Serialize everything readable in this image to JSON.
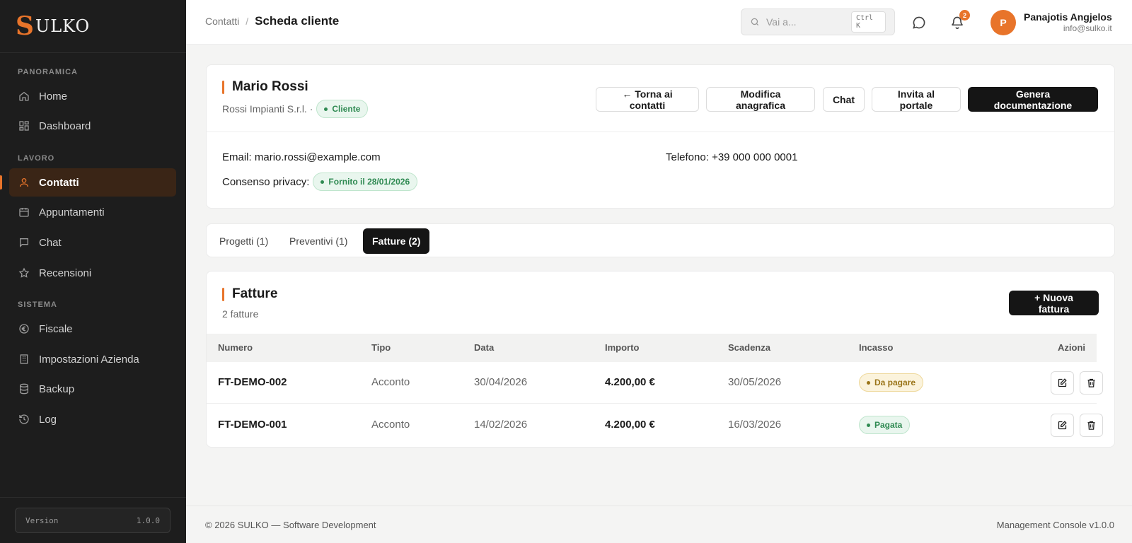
{
  "brand": {
    "logo_mark": "S",
    "logo_text": "ULKO",
    "accent": "#e8742a"
  },
  "sidebar": {
    "sections": [
      {
        "label": "PANORAMICA"
      },
      {
        "label": "LAVORO"
      },
      {
        "label": "SISTEMA"
      }
    ],
    "items": [
      {
        "label": "Home",
        "icon": "home-icon"
      },
      {
        "label": "Dashboard",
        "icon": "dashboard-icon"
      },
      {
        "label": "Contatti",
        "icon": "user-icon",
        "active": true
      },
      {
        "label": "Appuntamenti",
        "icon": "calendar-icon"
      },
      {
        "label": "Chat",
        "icon": "chat-icon"
      },
      {
        "label": "Recensioni",
        "icon": "star-icon"
      },
      {
        "label": "Fiscale",
        "icon": "euro-icon"
      },
      {
        "label": "Impostazioni Azienda",
        "icon": "building-icon"
      },
      {
        "label": "Backup",
        "icon": "database-icon"
      },
      {
        "label": "Log",
        "icon": "history-icon"
      }
    ],
    "version_label": "Version",
    "version_value": "1.0.0"
  },
  "topbar": {
    "breadcrumb_parent": "Contatti",
    "breadcrumb_sep": "/",
    "breadcrumb_current": "Scheda cliente",
    "search_placeholder": "Vai a...",
    "search_shortcut": "Ctrl K",
    "notification_count": "2",
    "user_initial": "P",
    "user_name": "Panajotis Angjelos",
    "user_email": "info@sulko.it"
  },
  "client": {
    "name": "Mario Rossi",
    "company": "Rossi Impianti S.r.l. ·",
    "status": "Cliente",
    "email_label": "Email:",
    "email": "mario.rossi@example.com",
    "phone_label": "Telefono:",
    "phone": "+39 000 000 0001",
    "privacy_label": "Consenso privacy:",
    "privacy_status": "Fornito il 28/01/2026",
    "actions": {
      "back": "← Torna ai contatti",
      "edit": "Modifica anagrafica",
      "chat": "Chat",
      "invite": "Invita al portale",
      "generate": "Genera documentazione"
    }
  },
  "tabs": [
    {
      "label": "Progetti (1)"
    },
    {
      "label": "Preventivi (1)"
    },
    {
      "label": "Fatture (2)",
      "active": true
    }
  ],
  "invoices": {
    "title": "Fatture",
    "subtitle": "2 fatture",
    "new_button": "+ Nuova fattura",
    "columns": [
      "Numero",
      "Tipo",
      "Data",
      "Importo",
      "Scadenza",
      "Incasso",
      "Azioni"
    ],
    "rows": [
      {
        "numero": "FT-DEMO-002",
        "tipo": "Acconto",
        "data": "30/04/2026",
        "importo": "4.200,00 €",
        "scadenza": "30/05/2026",
        "incasso": "Da pagare",
        "incasso_color": "#9a7418"
      },
      {
        "numero": "FT-DEMO-001",
        "tipo": "Acconto",
        "data": "14/02/2026",
        "importo": "4.200,00 €",
        "scadenza": "16/03/2026",
        "incasso": "Pagata",
        "incasso_color": "#2f8a52"
      }
    ]
  },
  "footer": {
    "left": "© 2026 SULKO — Software Development",
    "right": "Management Console v1.0.0"
  }
}
